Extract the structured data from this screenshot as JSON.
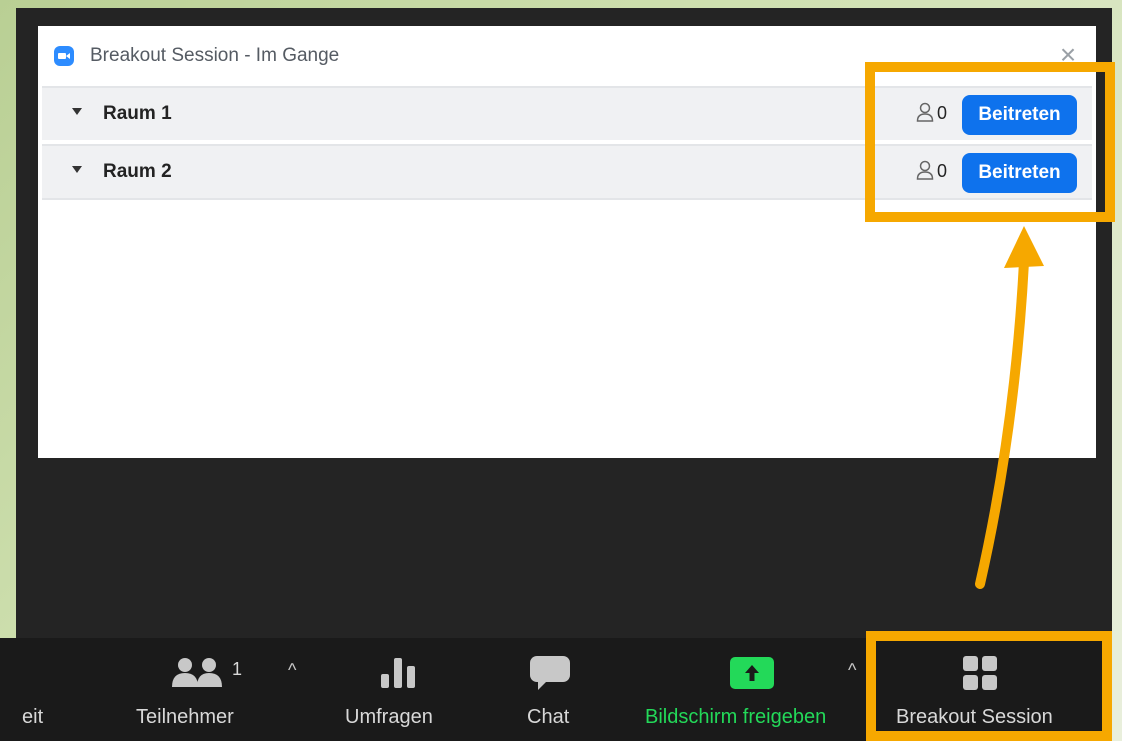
{
  "dialog": {
    "title": "Breakout Session - Im Gange",
    "close_glyph": "×",
    "rooms": [
      {
        "name": "Raum 1",
        "count": "0",
        "join_label": "Beitreten"
      },
      {
        "name": "Raum 2",
        "count": "0",
        "join_label": "Beitreten"
      }
    ]
  },
  "toolbar": {
    "cut_label": "eit",
    "participants_label": "Teilnehmer",
    "participants_count": "1",
    "polls_label": "Umfragen",
    "chat_label": "Chat",
    "share_label": "Bildschirm freigeben",
    "breakout_label": "Breakout Session",
    "caret": "^"
  },
  "colors": {
    "accent_blue": "#0e72ed",
    "highlight_orange": "#f6a800",
    "share_green": "#23d959"
  }
}
